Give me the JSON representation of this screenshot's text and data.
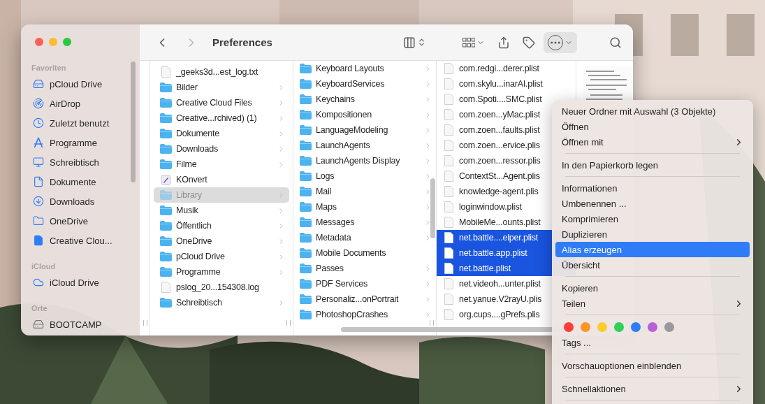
{
  "window": {
    "title": "Preferences",
    "navigation": {
      "back": {
        "disabled": false
      },
      "forward": {
        "disabled": true
      }
    },
    "actions_button": {
      "pressed": true
    }
  },
  "sidebar": {
    "sections": [
      {
        "header": "Favoriten",
        "items": [
          {
            "label": "pCloud Drive"
          },
          {
            "label": "AirDrop"
          },
          {
            "label": "Zuletzt benutzt"
          },
          {
            "label": "Programme"
          },
          {
            "label": "Schreibtisch"
          },
          {
            "label": "Dokumente"
          },
          {
            "label": "Downloads"
          },
          {
            "label": "OneDrive"
          },
          {
            "label": "Creative Clou..."
          }
        ]
      },
      {
        "header": "iCloud",
        "items": [
          {
            "label": "iCloud Drive"
          }
        ]
      },
      {
        "header": "Orte",
        "items": [
          {
            "label": "BOOTCAMP"
          }
        ]
      }
    ]
  },
  "columns": [
    {
      "items": [
        {
          "name": "_geeks3d...est_log.txt",
          "kind": "file",
          "has_children": false,
          "selected": false,
          "dimmed": false
        },
        {
          "name": "Bilder",
          "kind": "folder",
          "has_children": true,
          "selected": false,
          "dimmed": false
        },
        {
          "name": "Creative Cloud Files",
          "kind": "folder",
          "has_children": true,
          "selected": false,
          "dimmed": false
        },
        {
          "name": "Creative...rchived) (1)",
          "kind": "folder",
          "has_children": true,
          "selected": false,
          "dimmed": false
        },
        {
          "name": "Dokumente",
          "kind": "folder",
          "has_children": true,
          "selected": false,
          "dimmed": false
        },
        {
          "name": "Downloads",
          "kind": "folder",
          "has_children": true,
          "selected": false,
          "dimmed": false
        },
        {
          "name": "Filme",
          "kind": "folder",
          "has_children": true,
          "selected": false,
          "dimmed": false
        },
        {
          "name": "KOnvert",
          "kind": "app",
          "has_children": false,
          "selected": false,
          "dimmed": false
        },
        {
          "name": "Library",
          "kind": "folder",
          "has_children": true,
          "selected": true,
          "dimmed": true
        },
        {
          "name": "Musik",
          "kind": "folder",
          "has_children": true,
          "selected": false,
          "dimmed": false
        },
        {
          "name": "Öffentlich",
          "kind": "folder",
          "has_children": true,
          "selected": false,
          "dimmed": false
        },
        {
          "name": "OneDrive",
          "kind": "folder",
          "has_children": true,
          "selected": false,
          "dimmed": false
        },
        {
          "name": "pCloud Drive",
          "kind": "folder",
          "has_children": true,
          "selected": false,
          "dimmed": false
        },
        {
          "name": "Programme",
          "kind": "folder",
          "has_children": true,
          "selected": false,
          "dimmed": false
        },
        {
          "name": "pslog_20...154308.log",
          "kind": "file",
          "has_children": false,
          "selected": false,
          "dimmed": false
        },
        {
          "name": "Schreibtisch",
          "kind": "folder",
          "has_children": true,
          "selected": false,
          "dimmed": false
        }
      ]
    },
    {
      "items": [
        {
          "name": "Keyboard Layouts",
          "kind": "folder",
          "has_children": true,
          "selected": false,
          "dimmed": false
        },
        {
          "name": "KeyboardServices",
          "kind": "folder",
          "has_children": true,
          "selected": false,
          "dimmed": false
        },
        {
          "name": "Keychains",
          "kind": "folder",
          "has_children": true,
          "selected": false,
          "dimmed": false
        },
        {
          "name": "Kompositionen",
          "kind": "folder",
          "has_children": true,
          "selected": false,
          "dimmed": false
        },
        {
          "name": "LanguageModeling",
          "kind": "folder",
          "has_children": true,
          "selected": false,
          "dimmed": false
        },
        {
          "name": "LaunchAgents",
          "kind": "folder",
          "has_children": true,
          "selected": false,
          "dimmed": false
        },
        {
          "name": "LaunchAgents Display",
          "kind": "folder",
          "has_children": true,
          "selected": false,
          "dimmed": false
        },
        {
          "name": "Logs",
          "kind": "folder",
          "has_children": true,
          "selected": false,
          "dimmed": false
        },
        {
          "name": "Mail",
          "kind": "folder",
          "has_children": true,
          "selected": false,
          "dimmed": false
        },
        {
          "name": "Maps",
          "kind": "folder",
          "has_children": true,
          "selected": false,
          "dimmed": false
        },
        {
          "name": "Messages",
          "kind": "folder",
          "has_children": true,
          "selected": false,
          "dimmed": false
        },
        {
          "name": "Metadata",
          "kind": "folder",
          "has_children": true,
          "selected": false,
          "dimmed": false
        },
        {
          "name": "Mobile Documents",
          "kind": "folder",
          "has_children": false,
          "selected": false,
          "dimmed": false
        },
        {
          "name": "Passes",
          "kind": "folder",
          "has_children": true,
          "selected": false,
          "dimmed": false
        },
        {
          "name": "PDF Services",
          "kind": "folder",
          "has_children": true,
          "selected": false,
          "dimmed": false
        },
        {
          "name": "Personaliz...onPortrait",
          "kind": "folder",
          "has_children": true,
          "selected": false,
          "dimmed": false
        },
        {
          "name": "PhotoshopCrashes",
          "kind": "folder",
          "has_children": true,
          "selected": false,
          "dimmed": false
        }
      ]
    },
    {
      "items": [
        {
          "name": "com.redgi...derer.plist",
          "kind": "file",
          "selected": false,
          "dimmed": false
        },
        {
          "name": "com.skylu...inarAI.plist",
          "kind": "file",
          "selected": false,
          "dimmed": false
        },
        {
          "name": "com.Spoti....SMC.plist",
          "kind": "file",
          "selected": false,
          "dimmed": false
        },
        {
          "name": "com.zoen...yMac.plist",
          "kind": "file",
          "selected": false,
          "dimmed": false
        },
        {
          "name": "com.zoen...faults.plist",
          "kind": "file",
          "selected": false,
          "dimmed": false
        },
        {
          "name": "com.zoen...ervice.plis",
          "kind": "file",
          "selected": false,
          "dimmed": false
        },
        {
          "name": "com.zoen...ressor.plis",
          "kind": "file",
          "selected": false,
          "dimmed": false
        },
        {
          "name": "ContextSt...Agent.plis",
          "kind": "file",
          "selected": false,
          "dimmed": false
        },
        {
          "name": "knowledge-agent.plis",
          "kind": "file",
          "selected": false,
          "dimmed": false
        },
        {
          "name": "loginwindow.plist",
          "kind": "file",
          "selected": false,
          "dimmed": false
        },
        {
          "name": "MobileMe...ounts.plist",
          "kind": "file",
          "selected": false,
          "dimmed": false
        },
        {
          "name": "net.battle....elper.plist",
          "kind": "file",
          "selected": true,
          "dimmed": false
        },
        {
          "name": "net.battle.app.plist",
          "kind": "file",
          "selected": true,
          "dimmed": false
        },
        {
          "name": "net.battle.plist",
          "kind": "file",
          "selected": true,
          "dimmed": false
        },
        {
          "name": "net.videoh...unter.plist",
          "kind": "file",
          "selected": false,
          "dimmed": false
        },
        {
          "name": "net.yanue.V2rayU.plis",
          "kind": "file",
          "selected": false,
          "dimmed": false
        },
        {
          "name": "org.cups....gPrefs.plis",
          "kind": "file",
          "selected": false,
          "dimmed": false
        }
      ]
    }
  ],
  "context_menu": {
    "sections": [
      {
        "items": [
          {
            "label": "Neuer Ordner mit Auswahl (3 Objekte)",
            "has_submenu": false,
            "selected": false
          },
          {
            "label": "Öffnen",
            "has_submenu": false,
            "selected": false
          },
          {
            "label": "Öffnen mit",
            "has_submenu": true,
            "selected": false
          }
        ]
      },
      {
        "items": [
          {
            "label": "In den Papierkorb legen",
            "has_submenu": false,
            "selected": false
          }
        ]
      },
      {
        "items": [
          {
            "label": "Informationen",
            "has_submenu": false,
            "selected": false
          },
          {
            "label": "Umbenennen ...",
            "has_submenu": false,
            "selected": false
          },
          {
            "label": "Komprimieren",
            "has_submenu": false,
            "selected": false
          },
          {
            "label": "Duplizieren",
            "has_submenu": false,
            "selected": false
          },
          {
            "label": "Alias erzeugen",
            "has_submenu": false,
            "selected": true
          },
          {
            "label": "Übersicht",
            "has_submenu": false,
            "selected": false
          }
        ]
      },
      {
        "items": [
          {
            "label": "Kopieren",
            "has_submenu": false,
            "selected": false
          },
          {
            "label": "Teilen",
            "has_submenu": true,
            "selected": false
          }
        ]
      },
      {
        "tags": [
          {
            "color": "#fc3d39"
          },
          {
            "color": "#fd9426"
          },
          {
            "color": "#fecb2f"
          },
          {
            "color": "#2fd158"
          },
          {
            "color": "#2f7cf6"
          },
          {
            "color": "#b95fd6"
          },
          {
            "color": "#98989d"
          }
        ],
        "items": [
          {
            "label": "Tags ...",
            "has_submenu": false,
            "selected": false
          }
        ]
      },
      {
        "items": [
          {
            "label": "Vorschauoptionen einblenden",
            "has_submenu": false,
            "selected": false
          }
        ]
      },
      {
        "items": [
          {
            "label": "Schnellaktionen",
            "has_submenu": true,
            "selected": false
          }
        ]
      }
    ]
  }
}
